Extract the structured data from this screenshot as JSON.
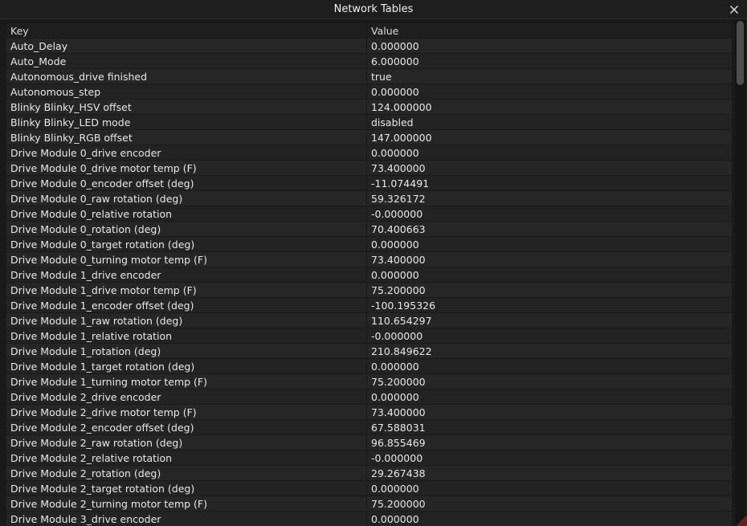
{
  "window": {
    "title": "Network Tables"
  },
  "table": {
    "headers": {
      "key": "Key",
      "value": "Value"
    },
    "rows": [
      {
        "key": "Auto_Delay",
        "value": "0.000000"
      },
      {
        "key": "Auto_Mode",
        "value": "6.000000"
      },
      {
        "key": "Autonomous_drive finished",
        "value": "true"
      },
      {
        "key": "Autonomous_step",
        "value": "0.000000"
      },
      {
        "key": "Blinky Blinky_HSV offset",
        "value": "124.000000"
      },
      {
        "key": "Blinky Blinky_LED mode",
        "value": "disabled"
      },
      {
        "key": "Blinky Blinky_RGB offset",
        "value": "147.000000"
      },
      {
        "key": "Drive Module 0_drive encoder",
        "value": "0.000000"
      },
      {
        "key": "Drive Module 0_drive motor temp (F)",
        "value": "73.400000"
      },
      {
        "key": "Drive Module 0_encoder offset (deg)",
        "value": "-11.074491"
      },
      {
        "key": "Drive Module 0_raw rotation (deg)",
        "value": "59.326172"
      },
      {
        "key": "Drive Module 0_relative rotation",
        "value": "-0.000000"
      },
      {
        "key": "Drive Module 0_rotation (deg)",
        "value": "70.400663"
      },
      {
        "key": "Drive Module 0_target rotation (deg)",
        "value": "0.000000"
      },
      {
        "key": "Drive Module 0_turning motor temp (F)",
        "value": "73.400000"
      },
      {
        "key": "Drive Module 1_drive encoder",
        "value": "0.000000"
      },
      {
        "key": "Drive Module 1_drive motor temp (F)",
        "value": "75.200000"
      },
      {
        "key": "Drive Module 1_encoder offset (deg)",
        "value": "-100.195326"
      },
      {
        "key": "Drive Module 1_raw rotation (deg)",
        "value": "110.654297"
      },
      {
        "key": "Drive Module 1_relative rotation",
        "value": "-0.000000"
      },
      {
        "key": "Drive Module 1_rotation (deg)",
        "value": "210.849622"
      },
      {
        "key": "Drive Module 1_target rotation (deg)",
        "value": "0.000000"
      },
      {
        "key": "Drive Module 1_turning motor temp (F)",
        "value": "75.200000"
      },
      {
        "key": "Drive Module 2_drive encoder",
        "value": "0.000000"
      },
      {
        "key": "Drive Module 2_drive motor temp (F)",
        "value": "73.400000"
      },
      {
        "key": "Drive Module 2_encoder offset (deg)",
        "value": "67.588031"
      },
      {
        "key": "Drive Module 2_raw rotation (deg)",
        "value": "96.855469"
      },
      {
        "key": "Drive Module 2_relative rotation",
        "value": "-0.000000"
      },
      {
        "key": "Drive Module 2_rotation (deg)",
        "value": "29.267438"
      },
      {
        "key": "Drive Module 2_target rotation (deg)",
        "value": "0.000000"
      },
      {
        "key": "Drive Module 2_turning motor temp (F)",
        "value": "75.200000"
      },
      {
        "key": "Drive Module 3_drive encoder",
        "value": "0.000000"
      }
    ]
  }
}
